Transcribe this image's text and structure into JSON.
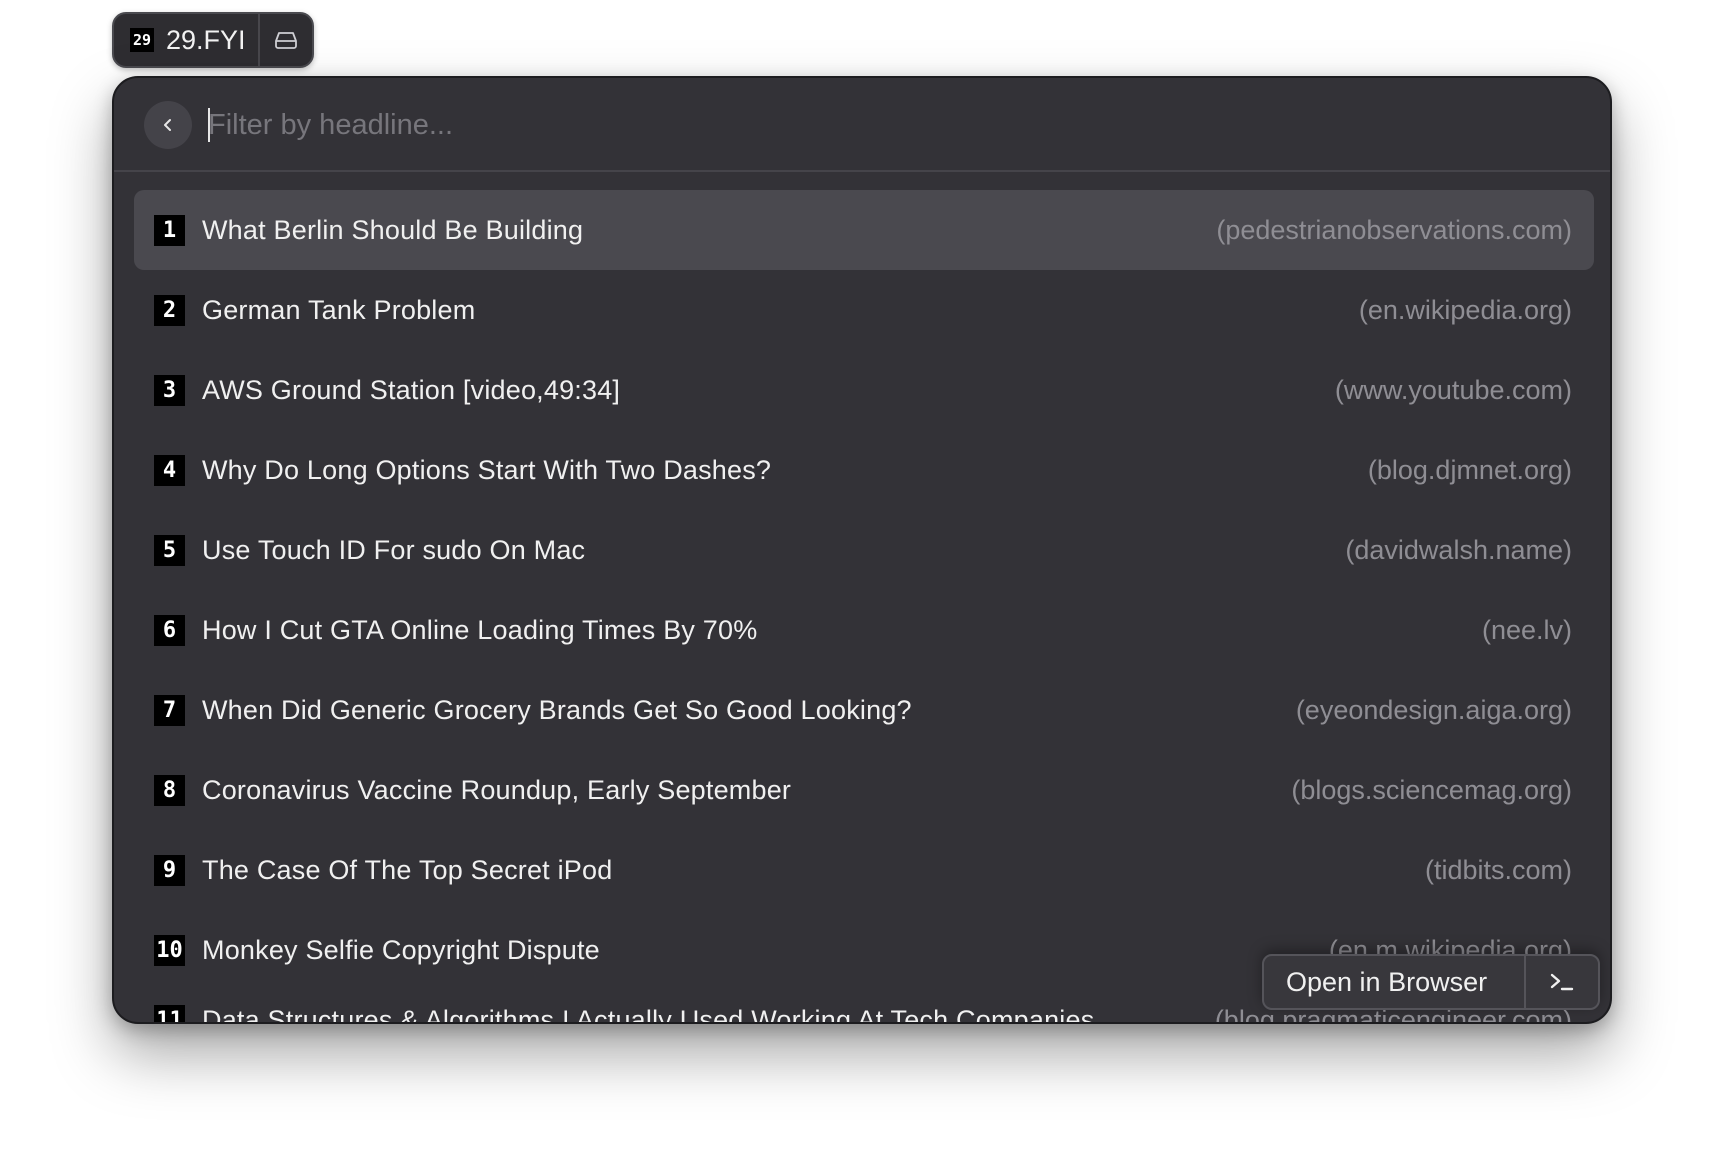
{
  "chip": {
    "badge": "29",
    "title": "29.FYI",
    "action_icon": "archive-tray-icon"
  },
  "search": {
    "placeholder": "Filter by headline...",
    "value": "",
    "back_icon": "chevron-left-icon"
  },
  "items": [
    {
      "rank": "1",
      "headline": "What Berlin Should Be Building",
      "domain": "(pedestrianobservations.com)",
      "selected": true
    },
    {
      "rank": "2",
      "headline": "German Tank Problem",
      "domain": "(en.wikipedia.org)"
    },
    {
      "rank": "3",
      "headline": "AWS Ground Station [video,49:34]",
      "domain": "(www.youtube.com)"
    },
    {
      "rank": "4",
      "headline": "Why Do Long Options Start With Two Dashes?",
      "domain": "(blog.djmnet.org)"
    },
    {
      "rank": "5",
      "headline": "Use Touch ID For sudo On Mac",
      "domain": "(davidwalsh.name)"
    },
    {
      "rank": "6",
      "headline": "How I Cut GTA Online Loading Times By 70%",
      "domain": "(nee.lv)"
    },
    {
      "rank": "7",
      "headline": "When Did Generic Grocery Brands Get So Good Looking?",
      "domain": "(eyeondesign.aiga.org)"
    },
    {
      "rank": "8",
      "headline": "Coronavirus Vaccine Roundup, Early September",
      "domain": "(blogs.sciencemag.org)"
    },
    {
      "rank": "9",
      "headline": "The Case Of The Top Secret iPod",
      "domain": "(tidbits.com)"
    },
    {
      "rank": "10",
      "headline": "Monkey Selfie Copyright Dispute",
      "domain": "(en.m.wikipedia.org)"
    },
    {
      "rank": "11",
      "headline": "Data Structures & Algorithms I Actually Used Working At Tech Companies",
      "domain": "(blog.pragmaticengineer.com)"
    }
  ],
  "action": {
    "label": "Open in Browser",
    "icon": "terminal-prompt-icon"
  },
  "colors": {
    "window_bg": "#333237",
    "selected_row": "#4a494f",
    "rank_badge": "#000000",
    "domain_text": "#8f8e94"
  }
}
